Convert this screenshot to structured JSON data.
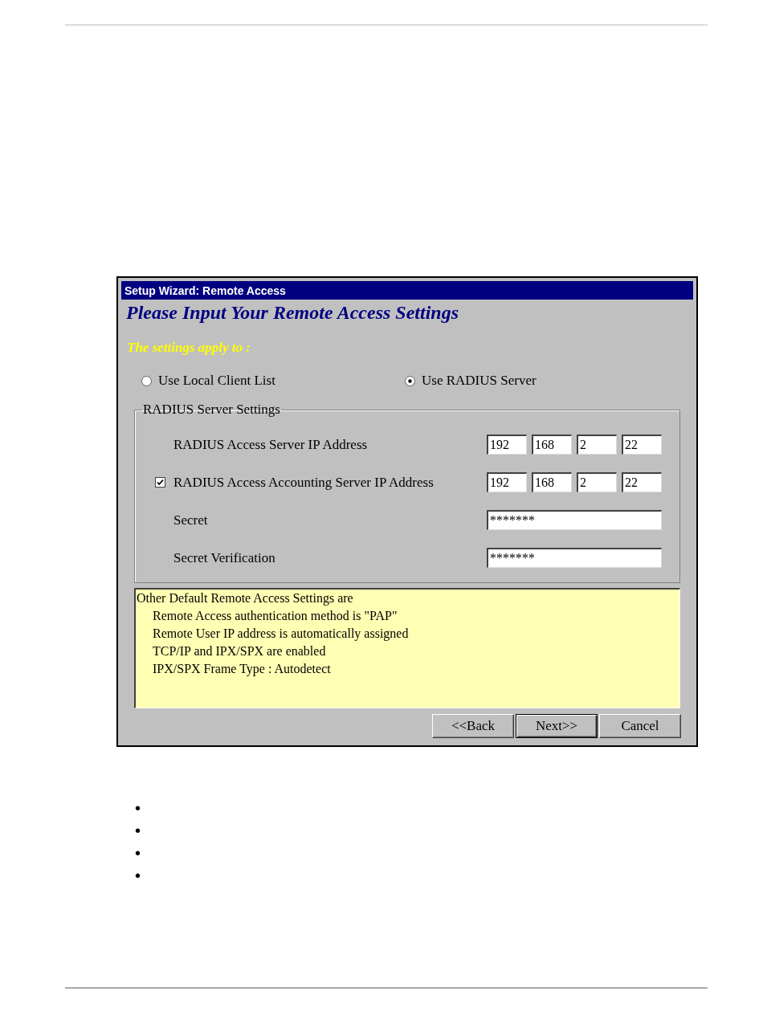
{
  "window": {
    "title": "Setup Wizard: Remote Access"
  },
  "heading": "Please Input Your Remote Access Settings",
  "apply_to": {
    "label": "The settings apply to :",
    "options": [
      {
        "label": "Use Local Client List",
        "selected": false
      },
      {
        "label": "Use RADIUS Server",
        "selected": true
      }
    ]
  },
  "radius_group": {
    "title": "RADIUS Server Settings",
    "rows": [
      {
        "kind": "ip",
        "label": "RADIUS Access Server IP Address",
        "octets": [
          "192",
          "168",
          "2",
          "22"
        ]
      },
      {
        "kind": "ip_toggle",
        "label": "RADIUS Access Accounting Server IP Address",
        "checked": true,
        "octets": [
          "192",
          "168",
          "2",
          "22"
        ]
      },
      {
        "kind": "secret",
        "label": "Secret",
        "value": "*******"
      },
      {
        "kind": "secret",
        "label": "Secret Verification",
        "value": "*******"
      }
    ]
  },
  "info_box": {
    "title": "Other Default Remote Access Settings are",
    "items": [
      "Remote Access authentication method is \"PAP\"",
      "Remote User IP address is automatically assigned",
      "TCP/IP and IPX/SPX are enabled",
      "IPX/SPX Frame Type : Autodetect"
    ]
  },
  "buttons": [
    {
      "label": "<<Back",
      "default": false
    },
    {
      "label": "Next>>",
      "default": true
    },
    {
      "label": "Cancel",
      "default": false
    }
  ],
  "bullets": [
    "•",
    "•",
    "•",
    "•"
  ]
}
